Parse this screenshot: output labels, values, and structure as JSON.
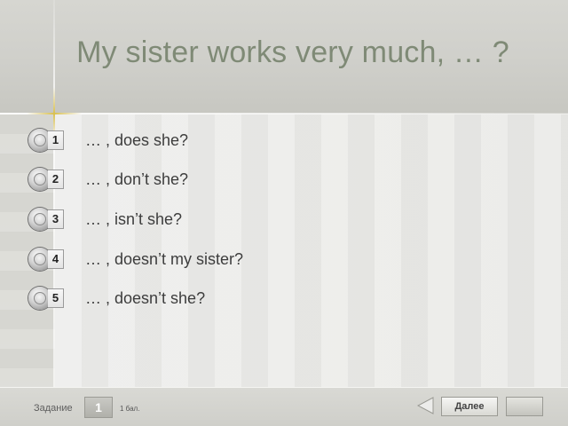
{
  "question": {
    "title": "My sister works very much, … ?"
  },
  "options": [
    {
      "number": "1",
      "text": "… , does she?"
    },
    {
      "number": "2",
      "text": "… , don’t she?"
    },
    {
      "number": "3",
      "text": "… , isn’t she?"
    },
    {
      "number": "4",
      "text": "… , doesn’t my sister?"
    },
    {
      "number": "5",
      "text": "… , doesn’t she?"
    }
  ],
  "footer": {
    "task_label": "Задание",
    "task_number": "1",
    "points": "1 бал.",
    "next_label": "Далее",
    "back_icon": "triangle-left-icon"
  }
}
